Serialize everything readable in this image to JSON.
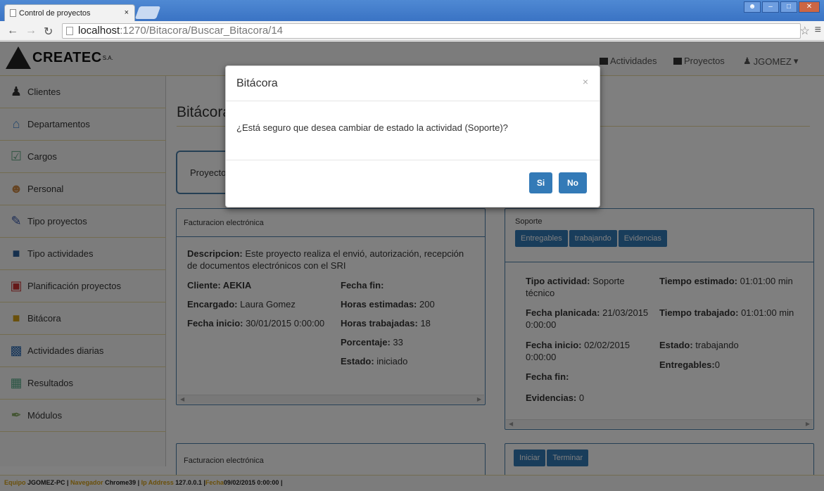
{
  "browser": {
    "tab_title": "Control de proyectos",
    "tab_close": "×",
    "url_host": "localhost",
    "url_rest": ":1270/Bitacora/Buscar_Bitacora/14"
  },
  "navbar": {
    "logo_text": "CREATEC",
    "logo_suffix": "S.A.",
    "links": [
      "Actividades",
      "Proyectos",
      "JGOMEZ"
    ],
    "user_caret": "▾"
  },
  "sidebar": {
    "items": [
      {
        "label": "Clientes",
        "icon": "client-icon"
      },
      {
        "label": "Departamentos",
        "icon": "house-icon"
      },
      {
        "label": "Cargos",
        "icon": "clipboard-icon"
      },
      {
        "label": "Personal",
        "icon": "people-icon"
      },
      {
        "label": "Tipo proyectos",
        "icon": "pencil-ruler-icon"
      },
      {
        "label": "Tipo actividades",
        "icon": "folder-icon"
      },
      {
        "label": "Planificación proyectos",
        "icon": "toolbox-icon"
      },
      {
        "label": "Bitácora",
        "icon": "folder-yellow-icon"
      },
      {
        "label": "Actividades diarias",
        "icon": "group-icon"
      },
      {
        "label": "Resultados",
        "icon": "spreadsheet-icon"
      },
      {
        "label": "Módulos",
        "icon": "pen-icon"
      }
    ]
  },
  "main": {
    "title": "Bitácora",
    "project_label": "Proyecto",
    "project_panel": {
      "header": "Facturacion electrónica",
      "descripcion_label": "Descripcion:",
      "descripcion_value": " Este proyecto realiza el envió, autorización, recepción de documentos electrónicos con el SRI",
      "cliente_label": "Cliente:",
      "cliente_value": " AEKIA",
      "encargado_label": "Encargado:",
      "encargado_value": " Laura Gomez",
      "fecha_inicio_label": "Fecha inicio:",
      "fecha_inicio_value": " 30/01/2015 0:00:00",
      "fecha_fin_label": "Fecha fin:",
      "horas_est_label": "Horas estimadas:",
      "horas_est_value": " 200",
      "horas_trab_label": "Horas trabajadas:",
      "horas_trab_value": " 18",
      "porcentaje_label": "Porcentaje:",
      "porcentaje_value": " 33",
      "estado_label": "Estado:",
      "estado_value": " iniciado"
    },
    "activity_panel": {
      "header": "Soporte",
      "buttons": [
        "Entregables",
        "trabajando",
        "Evidencias"
      ],
      "tipo_label": "Tipo actividad:",
      "tipo_value": " Soporte técnico",
      "fecha_plan_label": "Fecha planicada:",
      "fecha_plan_value": " 21/03/2015 0:00:00",
      "fecha_inicio_label": "Fecha inicio:",
      "fecha_inicio_value": " 02/02/2015 0:00:00",
      "fecha_fin_label": "Fecha fin:",
      "evidencias_label": "Evidencias:",
      "evidencias_value": " 0",
      "tiempo_est_label": "Tiempo estimado:",
      "tiempo_est_value": " 01:01:00 min",
      "tiempo_trab_label": "Tiempo trabajado:",
      "tiempo_trab_value": " 01:01:00 min",
      "estado_label": "Estado:",
      "estado_value": " trabajando",
      "entregables_label": "Entregables:",
      "entregables_value": "0"
    },
    "project_panel2_header": "Facturacion electrónica",
    "activity_buttons2": [
      "Iniciar",
      "Terminar"
    ]
  },
  "footer": {
    "equipo_label": "Equipo",
    "equipo_value": " JGOMEZ-PC |",
    "navegador_label": " Navegador",
    "navegador_value": " Chrome39 |",
    "ip_label": " Ip Address",
    "ip_value": " 127.0.0.1 |",
    "fecha_label": "Fecha",
    "fecha_value": "09/02/2015 0:00:00 |"
  },
  "modal": {
    "title": "Bitácora",
    "close": "×",
    "message": "¿Está seguro que desea cambiar de estado la actividad (Soporte)?",
    "yes_label": "Si",
    "no_label": "No"
  },
  "colors": {
    "primary": "#337ab7",
    "accent_yellow": "#d4a017",
    "panel_border": "#4a7ea8"
  }
}
